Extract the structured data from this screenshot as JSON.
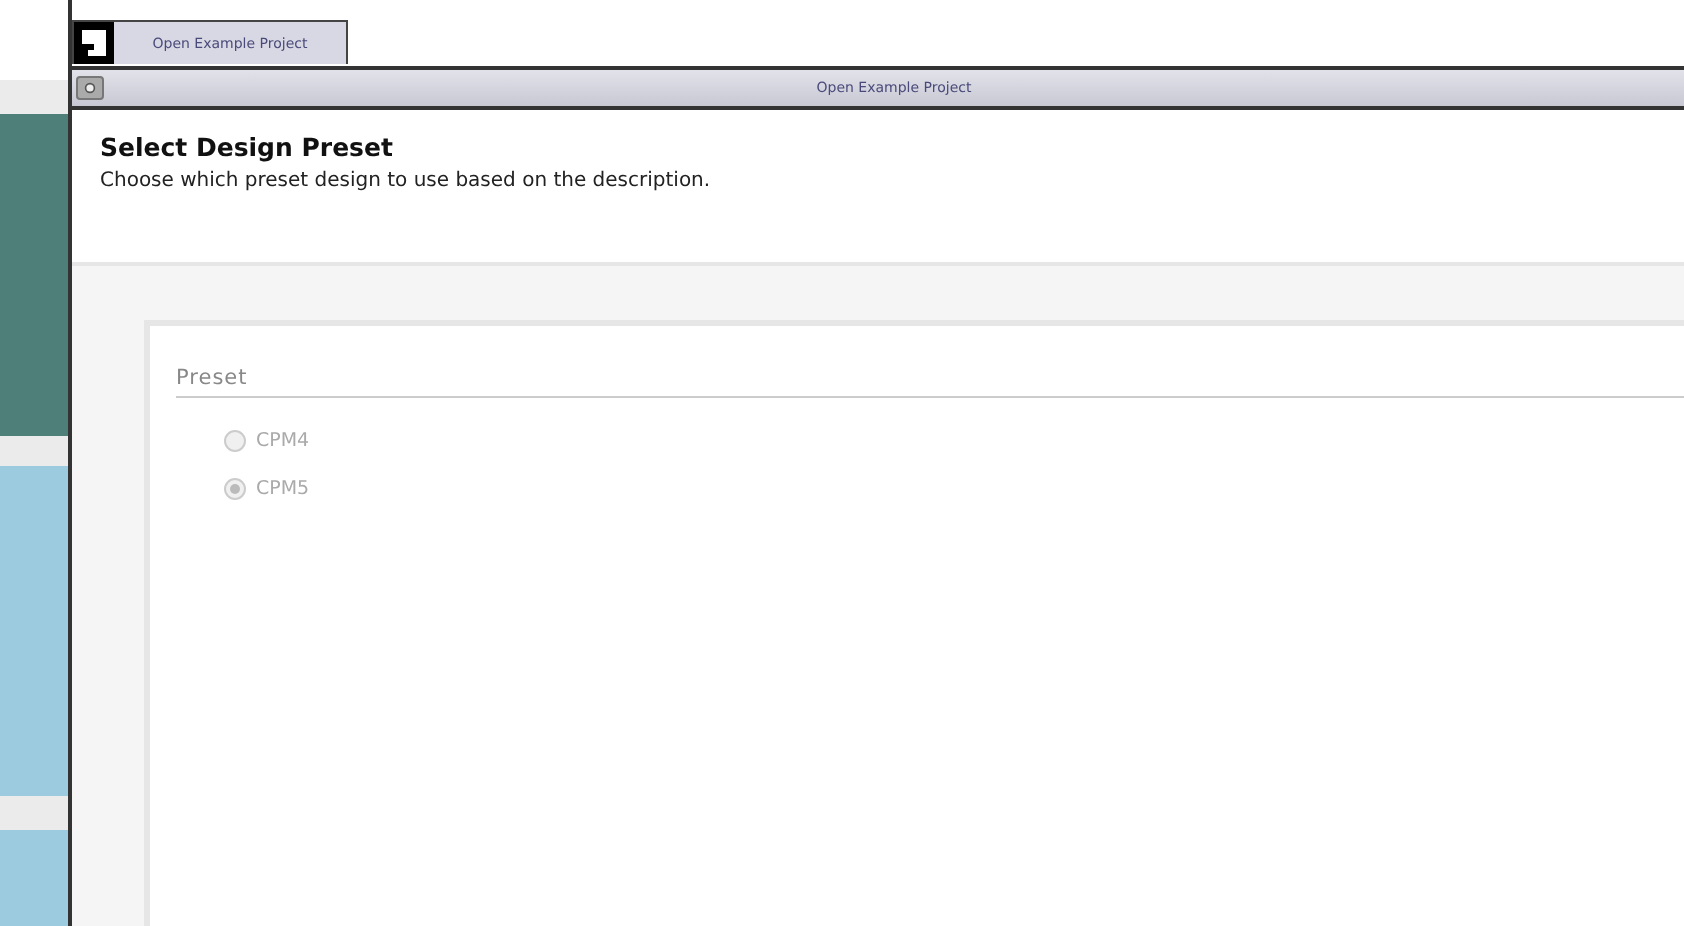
{
  "taskbar": {
    "button": {
      "title": "Open Example Project",
      "selected": true
    }
  },
  "window": {
    "title": "Open Example Project"
  },
  "header": {
    "title": "Select Design Preset",
    "description": "Choose which preset design to use based on the description."
  },
  "preset_group": {
    "legend": "Preset",
    "options": [
      {
        "label": "CPM4",
        "selected": false,
        "disabled": true
      },
      {
        "label": "CPM5",
        "selected": true,
        "disabled": true
      }
    ]
  }
}
